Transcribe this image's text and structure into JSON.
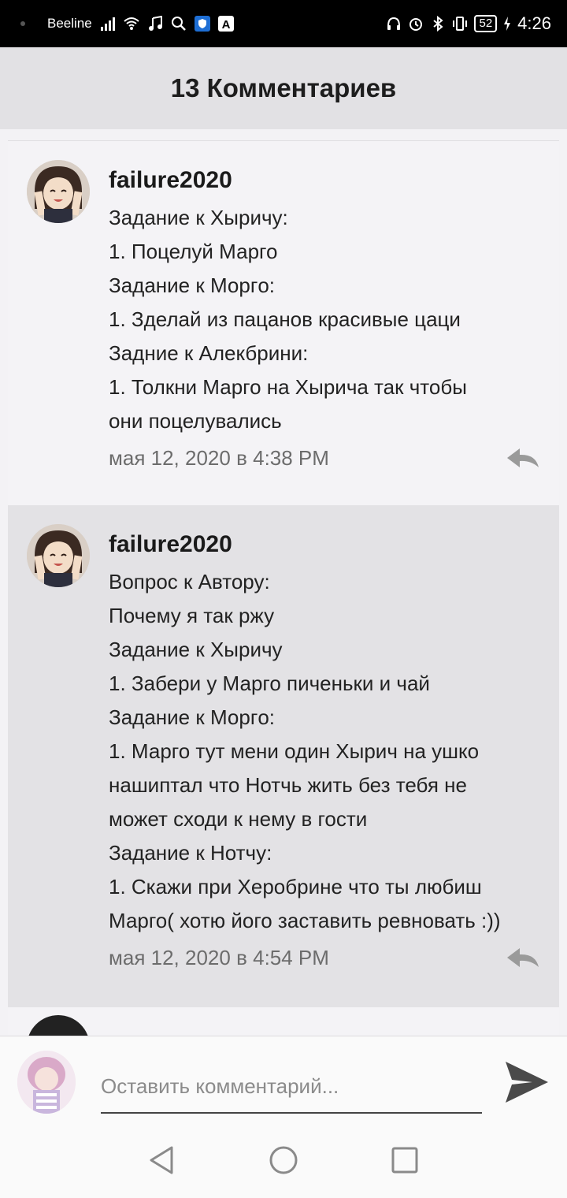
{
  "status_bar": {
    "carrier": "Beeline",
    "battery": "52",
    "time": "4:26"
  },
  "header": {
    "title": "13 Комментариев"
  },
  "comments": [
    {
      "author": "failure2020",
      "lines": [
        "Задание к Хыричу:",
        "1. Поцелуй Марго",
        "Задание к Моргo:",
        "1. Зделай из пацанов красивые цаци",
        "Задние к Алекбрини:",
        "1. Толкни Марго на Хырича так чтобы",
        "они поцелувались"
      ],
      "date": "мая 12, 2020 в 4:38 PM"
    },
    {
      "author": "failure2020",
      "lines": [
        "Вопрос к Автору:",
        "Почему я так ржу",
        "Задание к Хыричу",
        "1. Забери у Марго пиченьки и чай",
        "Задание к Моргo:",
        "1. Марго тут мени один Хырич на ушко",
        "нашиптал что Нотчь жить без тебя не",
        "может сходи к нему в гости",
        "Задание к Нотчу:",
        "1. Скажи при Херобрине что ты любиш",
        "Марго( хотю його заставить ревновать :))"
      ],
      "date": "мая 12, 2020 в 4:54 PM"
    }
  ],
  "composer": {
    "placeholder": "Оставить комментарий..."
  },
  "colors": {
    "header_bg": "#e2e1e4",
    "comment_bg_light": "#f4f3f6",
    "comment_bg_dark": "#e3e2e5",
    "reply_icon": "#9a9a9a",
    "send_icon": "#4a4a4a"
  },
  "icons": [
    "signal-icon",
    "wifi-icon",
    "music-icon",
    "search-icon",
    "shield-icon",
    "font-icon",
    "headphones-icon",
    "alarm-icon",
    "bluetooth-icon",
    "vibrate-icon",
    "charging-icon",
    "reply-icon",
    "send-icon",
    "back-icon",
    "home-icon",
    "recents-icon"
  ]
}
